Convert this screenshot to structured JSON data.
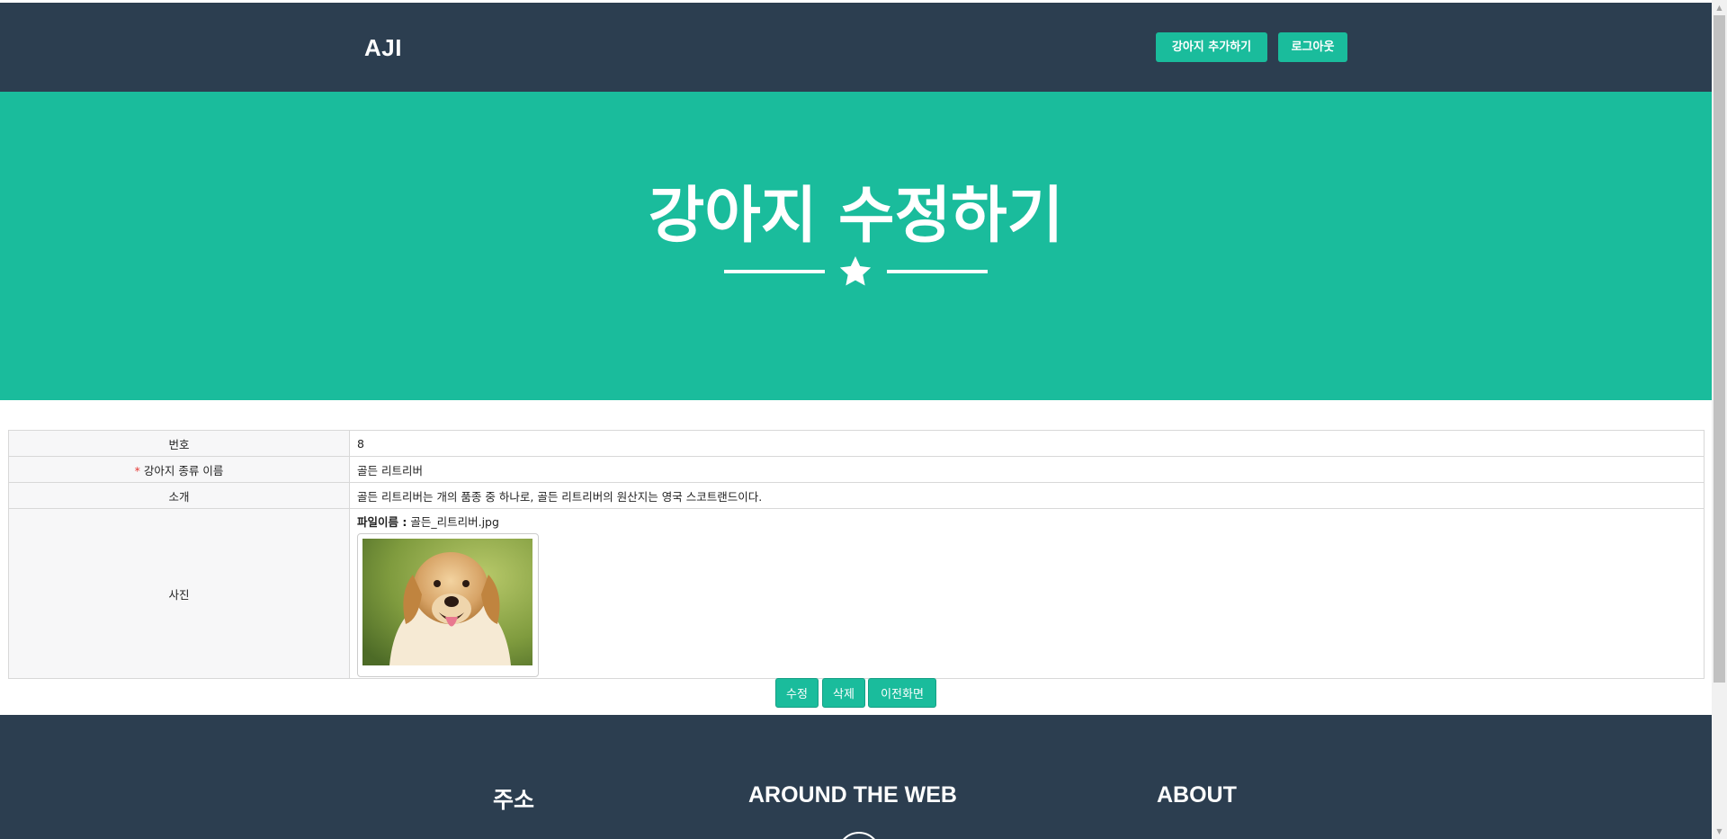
{
  "nav": {
    "brand": "AJI",
    "add_label": "강아지 추가하기",
    "logout_label": "로그아웃"
  },
  "masthead": {
    "title": "강아지 수정하기",
    "icon": "star-icon"
  },
  "table": {
    "rows": [
      {
        "label": "번호",
        "value": "8"
      },
      {
        "required_mark": "*",
        "label": "강아지 종류 이름",
        "value": "골든 리트리버"
      },
      {
        "label": "소개",
        "value": "골든 리트리버는 개의 품종 중 하나로, 골든 리트리버의 원산지는 영국 스코트랜드이다."
      },
      {
        "label": "사진",
        "file_label": "파일이름 :",
        "file_name": "골든_리트리버.jpg"
      }
    ]
  },
  "actions": {
    "edit_label": "수정",
    "delete_label": "삭제",
    "back_label": "이전화면"
  },
  "footer": {
    "col1_title": "주소",
    "col2_title": "AROUND THE WEB",
    "col3_title": "ABOUT"
  },
  "colors": {
    "navbar": "#2c3e50",
    "accent": "#1abc9c"
  }
}
